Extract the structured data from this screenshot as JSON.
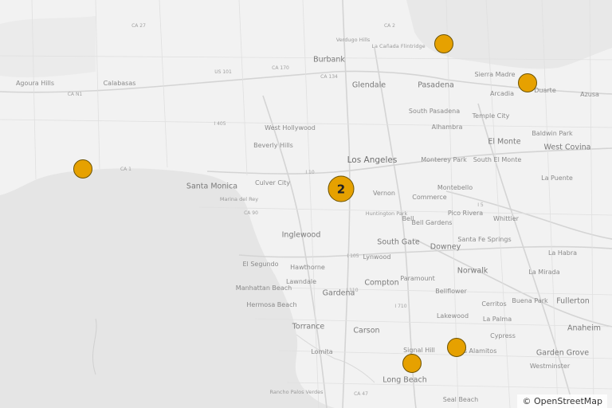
{
  "map": {
    "attribution": "© OpenStreetMap",
    "colors": {
      "land": "#f2f2f2",
      "ocean": "#e6e6e6",
      "marker": "#e6a100",
      "marker_border": "#6b5200"
    },
    "cities": [
      {
        "name": "Los Angeles",
        "size": "xl"
      },
      {
        "name": "Santa Monica",
        "size": "lg"
      },
      {
        "name": "Glendale",
        "size": "lg"
      },
      {
        "name": "Burbank",
        "size": "lg"
      },
      {
        "name": "Pasadena",
        "size": "lg"
      },
      {
        "name": "El Monte",
        "size": "lg"
      },
      {
        "name": "West Covina",
        "size": "lg"
      },
      {
        "name": "Inglewood",
        "size": "lg"
      },
      {
        "name": "South Gate",
        "size": "lg"
      },
      {
        "name": "Downey",
        "size": "lg"
      },
      {
        "name": "Norwalk",
        "size": "lg"
      },
      {
        "name": "Compton",
        "size": "lg"
      },
      {
        "name": "Gardena",
        "size": "lg"
      },
      {
        "name": "Torrance",
        "size": "lg"
      },
      {
        "name": "Carson",
        "size": "lg"
      },
      {
        "name": "Long Beach",
        "size": "lg"
      },
      {
        "name": "Fullerton",
        "size": "lg"
      },
      {
        "name": "Anaheim",
        "size": "lg"
      },
      {
        "name": "Garden Grove",
        "size": "lg"
      },
      {
        "name": "West Hollywood",
        "size": "md"
      },
      {
        "name": "Beverly Hills",
        "size": "md"
      },
      {
        "name": "Culver City",
        "size": "md"
      },
      {
        "name": "Alhambra",
        "size": "md"
      },
      {
        "name": "Monterey Park",
        "size": "md"
      },
      {
        "name": "South El Monte",
        "size": "md"
      },
      {
        "name": "Montebello",
        "size": "md"
      },
      {
        "name": "Pico Rivera",
        "size": "md"
      },
      {
        "name": "Whittier",
        "size": "md"
      },
      {
        "name": "La Puente",
        "size": "md"
      },
      {
        "name": "Baldwin Park",
        "size": "md"
      },
      {
        "name": "Temple City",
        "size": "md"
      },
      {
        "name": "South Pasadena",
        "size": "md"
      },
      {
        "name": "Arcadia",
        "size": "md"
      },
      {
        "name": "Sierra Madre",
        "size": "md"
      },
      {
        "name": "Azusa",
        "size": "md"
      },
      {
        "name": "Duarte",
        "size": "md"
      },
      {
        "name": "La Cañada Flintridge",
        "size": "sm"
      },
      {
        "name": "Calabasas",
        "size": "md"
      },
      {
        "name": "Agoura Hills",
        "size": "md"
      },
      {
        "name": "Vernon",
        "size": "md"
      },
      {
        "name": "Commerce",
        "size": "md"
      },
      {
        "name": "Bell",
        "size": "md"
      },
      {
        "name": "Bell Gardens",
        "size": "md"
      },
      {
        "name": "Huntington Park",
        "size": "sm"
      },
      {
        "name": "Santa Fe Springs",
        "size": "md"
      },
      {
        "name": "La Habra",
        "size": "md"
      },
      {
        "name": "La Mirada",
        "size": "md"
      },
      {
        "name": "Buena Park",
        "size": "md"
      },
      {
        "name": "Cerritos",
        "size": "md"
      },
      {
        "name": "La Palma",
        "size": "md"
      },
      {
        "name": "Cypress",
        "size": "md"
      },
      {
        "name": "Lakewood",
        "size": "md"
      },
      {
        "name": "Bellflower",
        "size": "md"
      },
      {
        "name": "Paramount",
        "size": "md"
      },
      {
        "name": "Lynwood",
        "size": "md"
      },
      {
        "name": "El Segundo",
        "size": "md"
      },
      {
        "name": "Hawthorne",
        "size": "md"
      },
      {
        "name": "Lawndale",
        "size": "md"
      },
      {
        "name": "Manhattan Beach",
        "size": "md"
      },
      {
        "name": "Hermosa Beach",
        "size": "md"
      },
      {
        "name": "Lomita",
        "size": "md"
      },
      {
        "name": "Signal Hill",
        "size": "md"
      },
      {
        "name": "Rancho Palos Verdes",
        "size": "sm"
      },
      {
        "name": "Westminster",
        "size": "md"
      },
      {
        "name": "Seal Beach",
        "size": "md"
      },
      {
        "name": "Los Alamitos",
        "size": "md"
      },
      {
        "name": "Verdugo Hills",
        "size": "sm"
      },
      {
        "name": "Marina del Rey",
        "size": "sm"
      }
    ],
    "highways": [
      "CA 27",
      "US 101",
      "CA 170",
      "CA 2",
      "I 405",
      "I 10",
      "I 105",
      "I 110",
      "CA 1",
      "CA 90",
      "CA N1",
      "I 710",
      "I 5",
      "CA 47",
      "CA 134"
    ],
    "markers": [
      {
        "kind": "single",
        "label": ""
      },
      {
        "kind": "single",
        "label": ""
      },
      {
        "kind": "single",
        "label": ""
      },
      {
        "kind": "cluster",
        "label": "2"
      },
      {
        "kind": "single",
        "label": ""
      },
      {
        "kind": "single",
        "label": ""
      }
    ]
  }
}
